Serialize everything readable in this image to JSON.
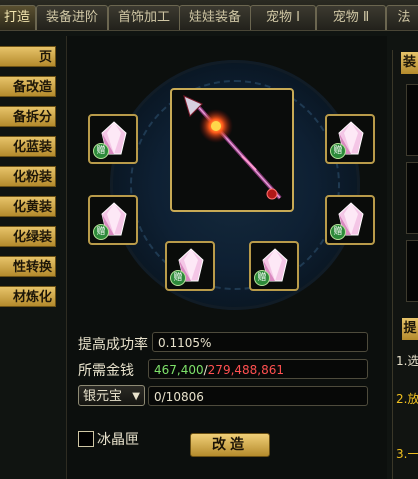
{
  "tabs": [
    {
      "label": "打造",
      "active": true
    },
    {
      "label": "装备进阶",
      "active": false
    },
    {
      "label": "首饰加工",
      "active": false
    },
    {
      "label": "娃娃装备",
      "active": false
    },
    {
      "label": "宠物 Ⅰ",
      "active": false
    },
    {
      "label": "宠物 Ⅱ",
      "active": false
    },
    {
      "label": "法",
      "active": false
    }
  ],
  "sidebar": {
    "items": [
      {
        "label": "页"
      },
      {
        "label": "备改造"
      },
      {
        "label": "备拆分"
      },
      {
        "label": "化蓝装"
      },
      {
        "label": "化粉装"
      },
      {
        "label": "化黄装"
      },
      {
        "label": "化绿装"
      },
      {
        "label": "性转换"
      },
      {
        "label": "材炼化"
      }
    ],
    "arrow": "›"
  },
  "slots": {
    "gift_badge": "赠",
    "count": 6
  },
  "form": {
    "success_label": "提高成功率",
    "success_value": "0.1105%",
    "money_label": "所需金钱",
    "money_have": "467,400",
    "money_sep": "/",
    "money_need": "279,488,861",
    "currency_select": "银元宝",
    "currency_value": "0/10806",
    "ice_box_label": "冰晶匣",
    "ice_box_checked": false,
    "modify_button": "改造"
  },
  "right_panel": {
    "tab_label": "装",
    "section_label": "提",
    "line1": "1.选",
    "line2": "2.放",
    "line3": "3.一"
  },
  "colors": {
    "accent_gold": "#c8aa55",
    "money_green": "#7ee26a",
    "money_red": "#ff5050",
    "instruction_yellow": "#f0c020"
  }
}
